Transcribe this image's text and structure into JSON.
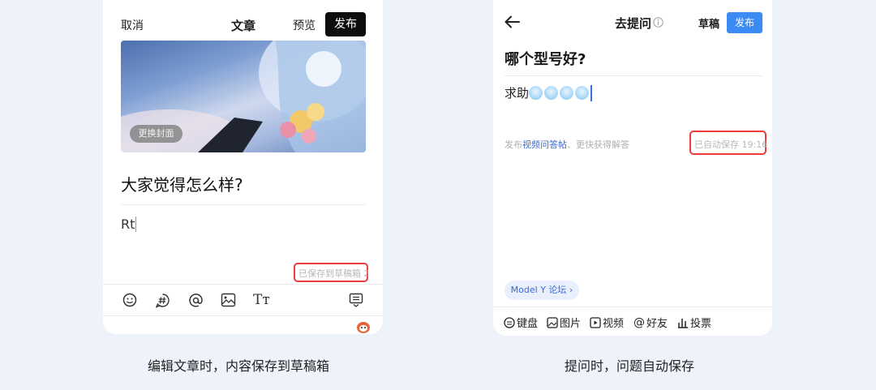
{
  "left": {
    "cancel_label": "取消",
    "title": "文章",
    "preview_label": "预览",
    "publish_label": "发布",
    "change_cover_label": "更换封面",
    "article_title": "大家觉得怎么样?",
    "body_text": "Rt",
    "saved_status": "已保存到草稿箱 2",
    "toolbar_icons": [
      "emoji-icon",
      "hashtag-icon",
      "mention-icon",
      "image-icon",
      "text-format-icon",
      "keyboard-toggle-icon"
    ],
    "caption": "编辑文章时，内容保存到草稿箱"
  },
  "right": {
    "header_title": "去提问",
    "draft_label": "草稿",
    "publish_label": "发布",
    "question_title": "哪个型号好?",
    "body_text": "求助",
    "hint_prefix": "发布",
    "hint_link": "视频问答帖",
    "hint_suffix": "、更快获得解答",
    "autosave_status": "已自动保存 19:16",
    "forum_tag": "Model Y 论坛",
    "toolbar": [
      {
        "icon": "keyboard-icon",
        "label": "键盘"
      },
      {
        "icon": "picture-icon",
        "label": "图片"
      },
      {
        "icon": "video-icon",
        "label": "视频"
      },
      {
        "icon": "at-icon",
        "label": "好友"
      },
      {
        "icon": "poll-icon",
        "label": "投票"
      }
    ],
    "caption": "提问时，问题自动保存"
  },
  "colors": {
    "background": "#eef2fa",
    "highlight_red": "#ee3b3b",
    "accent_blue": "#3c8bf5",
    "link_blue": "#3a6bd4"
  }
}
